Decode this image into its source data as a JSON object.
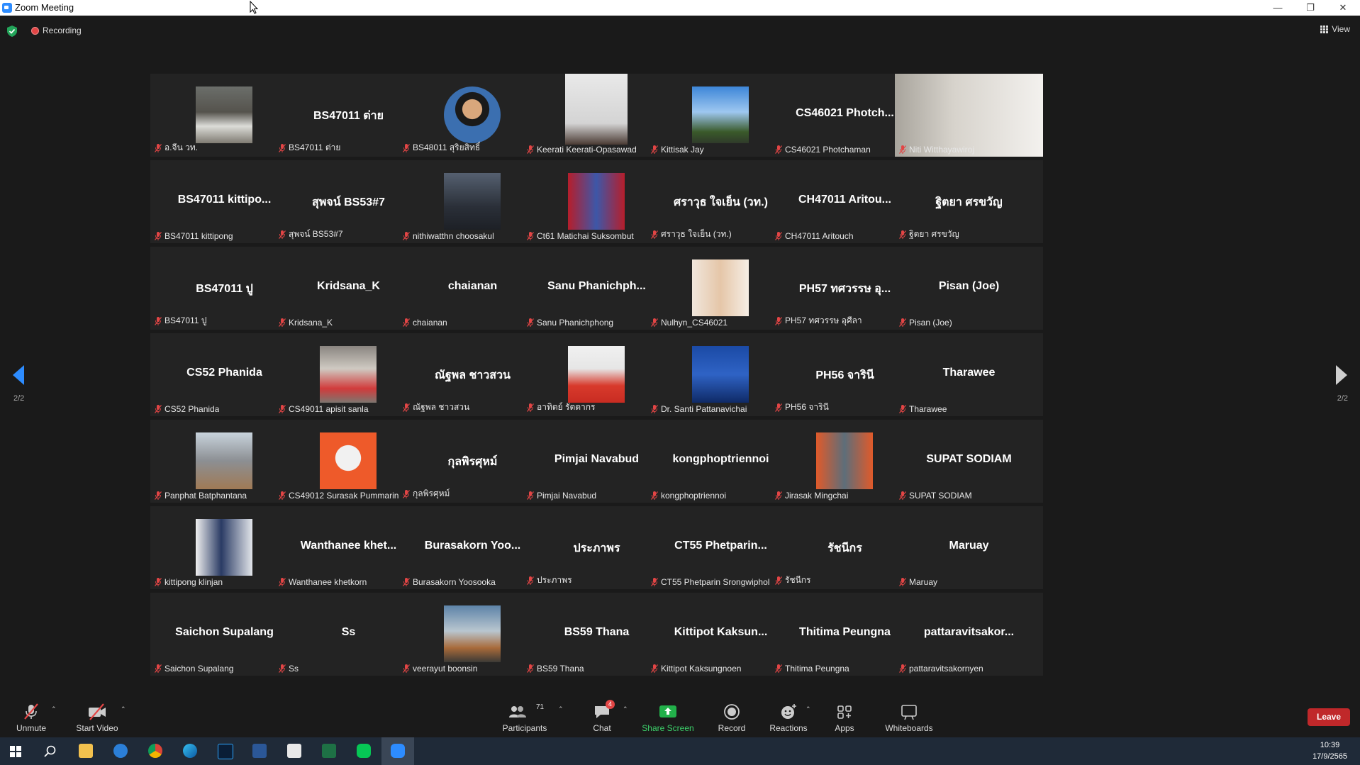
{
  "window": {
    "title": "Zoom Meeting"
  },
  "topbar": {
    "recording": "Recording",
    "view": "View"
  },
  "paging": {
    "indicator": "2/2"
  },
  "tiles": [
    {
      "big": "",
      "label": "อ.จีน วท.",
      "photo": "p1"
    },
    {
      "big": "BS47011 ต่าย",
      "label": "BS47011 ต่าย",
      "photo": ""
    },
    {
      "big": "",
      "label": "BS48011 สุริยสิทธิ์",
      "photo": "p2"
    },
    {
      "big": "",
      "label": "Keerati Keerati-Opasawad",
      "photo": "p3"
    },
    {
      "big": "",
      "label": "Kittisak Jay",
      "photo": "p4"
    },
    {
      "big": "CS46021 Photch...",
      "label": "CS46021 Photchaman",
      "photo": ""
    },
    {
      "big": "",
      "label": "Niti Witthayawiroj",
      "photo": "p5"
    },
    {
      "big": "BS47011 kittipo...",
      "label": "BS47011 kittipong",
      "photo": ""
    },
    {
      "big": "สุพจน์ BS53#7",
      "label": "สุพจน์ BS53#7",
      "photo": ""
    },
    {
      "big": "",
      "label": "nithiwatthn choosakul",
      "photo": "p6"
    },
    {
      "big": "",
      "label": "Ct61 Matichai Suksombut",
      "photo": "p7"
    },
    {
      "big": "ศราวุธ ใจเย็น (วท.)",
      "label": "ศราวุธ ใจเย็น (วท.)",
      "photo": ""
    },
    {
      "big": "CH47011 Aritou...",
      "label": "CH47011 Aritouch",
      "photo": ""
    },
    {
      "big": "ฐิตยา ศรขวัญ",
      "label": "ฐิตยา ศรขวัญ",
      "photo": ""
    },
    {
      "big": "BS47011 ปู",
      "label": "BS47011 ปู",
      "photo": ""
    },
    {
      "big": "Kridsana_K",
      "label": "Kridsana_K",
      "photo": ""
    },
    {
      "big": "chaianan",
      "label": "chaianan",
      "photo": ""
    },
    {
      "big": "Sanu Phanichph...",
      "label": "Sanu Phanichphong",
      "photo": ""
    },
    {
      "big": "",
      "label": "Nulhyn_CS46021",
      "photo": "p8"
    },
    {
      "big": "PH57 ทศวรรษ อุ...",
      "label": "PH57 ทศวรรษ อุศีลา",
      "photo": ""
    },
    {
      "big": "Pisan (Joe)",
      "label": "Pisan (Joe)",
      "photo": ""
    },
    {
      "big": "CS52 Phanida",
      "label": "CS52 Phanida",
      "photo": ""
    },
    {
      "big": "",
      "label": "CS49011 apisit sanla",
      "photo": "p9"
    },
    {
      "big": "ณัฐพล ชาวสวน",
      "label": "ณัฐพล ชาวสวน",
      "photo": ""
    },
    {
      "big": "",
      "label": "อาทิตย์ รัตตากร",
      "photo": "p10"
    },
    {
      "big": "",
      "label": "Dr. Santi Pattanavichai",
      "photo": "p11"
    },
    {
      "big": "PH56 จารินี",
      "label": "PH56 จารินี",
      "photo": ""
    },
    {
      "big": "Tharawee",
      "label": "Tharawee",
      "photo": ""
    },
    {
      "big": "",
      "label": "Panphat Batphantana",
      "photo": "p12"
    },
    {
      "big": "",
      "label": "CS49012 Surasak Pummarin",
      "photo": "p13"
    },
    {
      "big": "กุลพิรศุหม์",
      "label": "กุลพิรศุหม์",
      "photo": ""
    },
    {
      "big": "Pimjai Navabud",
      "label": "Pimjai Navabud",
      "photo": ""
    },
    {
      "big": "kongphoptriennoi",
      "label": "kongphoptriennoi",
      "photo": ""
    },
    {
      "big": "",
      "label": "Jirasak Mingchai",
      "photo": "p14"
    },
    {
      "big": "SUPAT SODIAM",
      "label": "SUPAT SODIAM",
      "photo": ""
    },
    {
      "big": "",
      "label": "kittipong klinjan",
      "photo": "p15"
    },
    {
      "big": "Wanthanee khet...",
      "label": "Wanthanee khetkorn",
      "photo": ""
    },
    {
      "big": "Burasakorn Yoo...",
      "label": "Burasakorn Yoosooka",
      "photo": ""
    },
    {
      "big": "ประภาพร",
      "label": "ประภาพร",
      "photo": ""
    },
    {
      "big": "CT55 Phetparin...",
      "label": "CT55 Phetparin Srongwiphol",
      "photo": ""
    },
    {
      "big": "รัชนีกร",
      "label": "รัชนีกร",
      "photo": ""
    },
    {
      "big": "Maruay",
      "label": "Maruay",
      "photo": ""
    },
    {
      "big": "Saichon Supalang",
      "label": "Saichon Supalang",
      "photo": ""
    },
    {
      "big": "Ss",
      "label": "Ss",
      "photo": ""
    },
    {
      "big": "",
      "label": "veerayut boonsin",
      "photo": "p16"
    },
    {
      "big": "BS59 Thana",
      "label": "BS59 Thana",
      "photo": ""
    },
    {
      "big": "Kittipot Kaksun...",
      "label": "Kittipot Kaksungnoen",
      "photo": ""
    },
    {
      "big": "Thitima Peungna",
      "label": "Thitima Peungna",
      "photo": ""
    },
    {
      "big": "pattaravitsakor...",
      "label": "pattaravitsakornyen",
      "photo": ""
    }
  ],
  "toolbar": {
    "unmute": "Unmute",
    "start_video": "Start Video",
    "participants": "Participants",
    "participants_count": "71",
    "chat": "Chat",
    "chat_badge": "4",
    "share_screen": "Share Screen",
    "record": "Record",
    "reactions": "Reactions",
    "apps": "Apps",
    "whiteboards": "Whiteboards",
    "leave": "Leave"
  },
  "taskbar": {
    "time": "10:39",
    "date": "17/9/2565"
  },
  "colors": {
    "accent": "#2d8cff",
    "leave": "#c0282a",
    "share": "#22b04a",
    "mic_off": "#e24545"
  }
}
